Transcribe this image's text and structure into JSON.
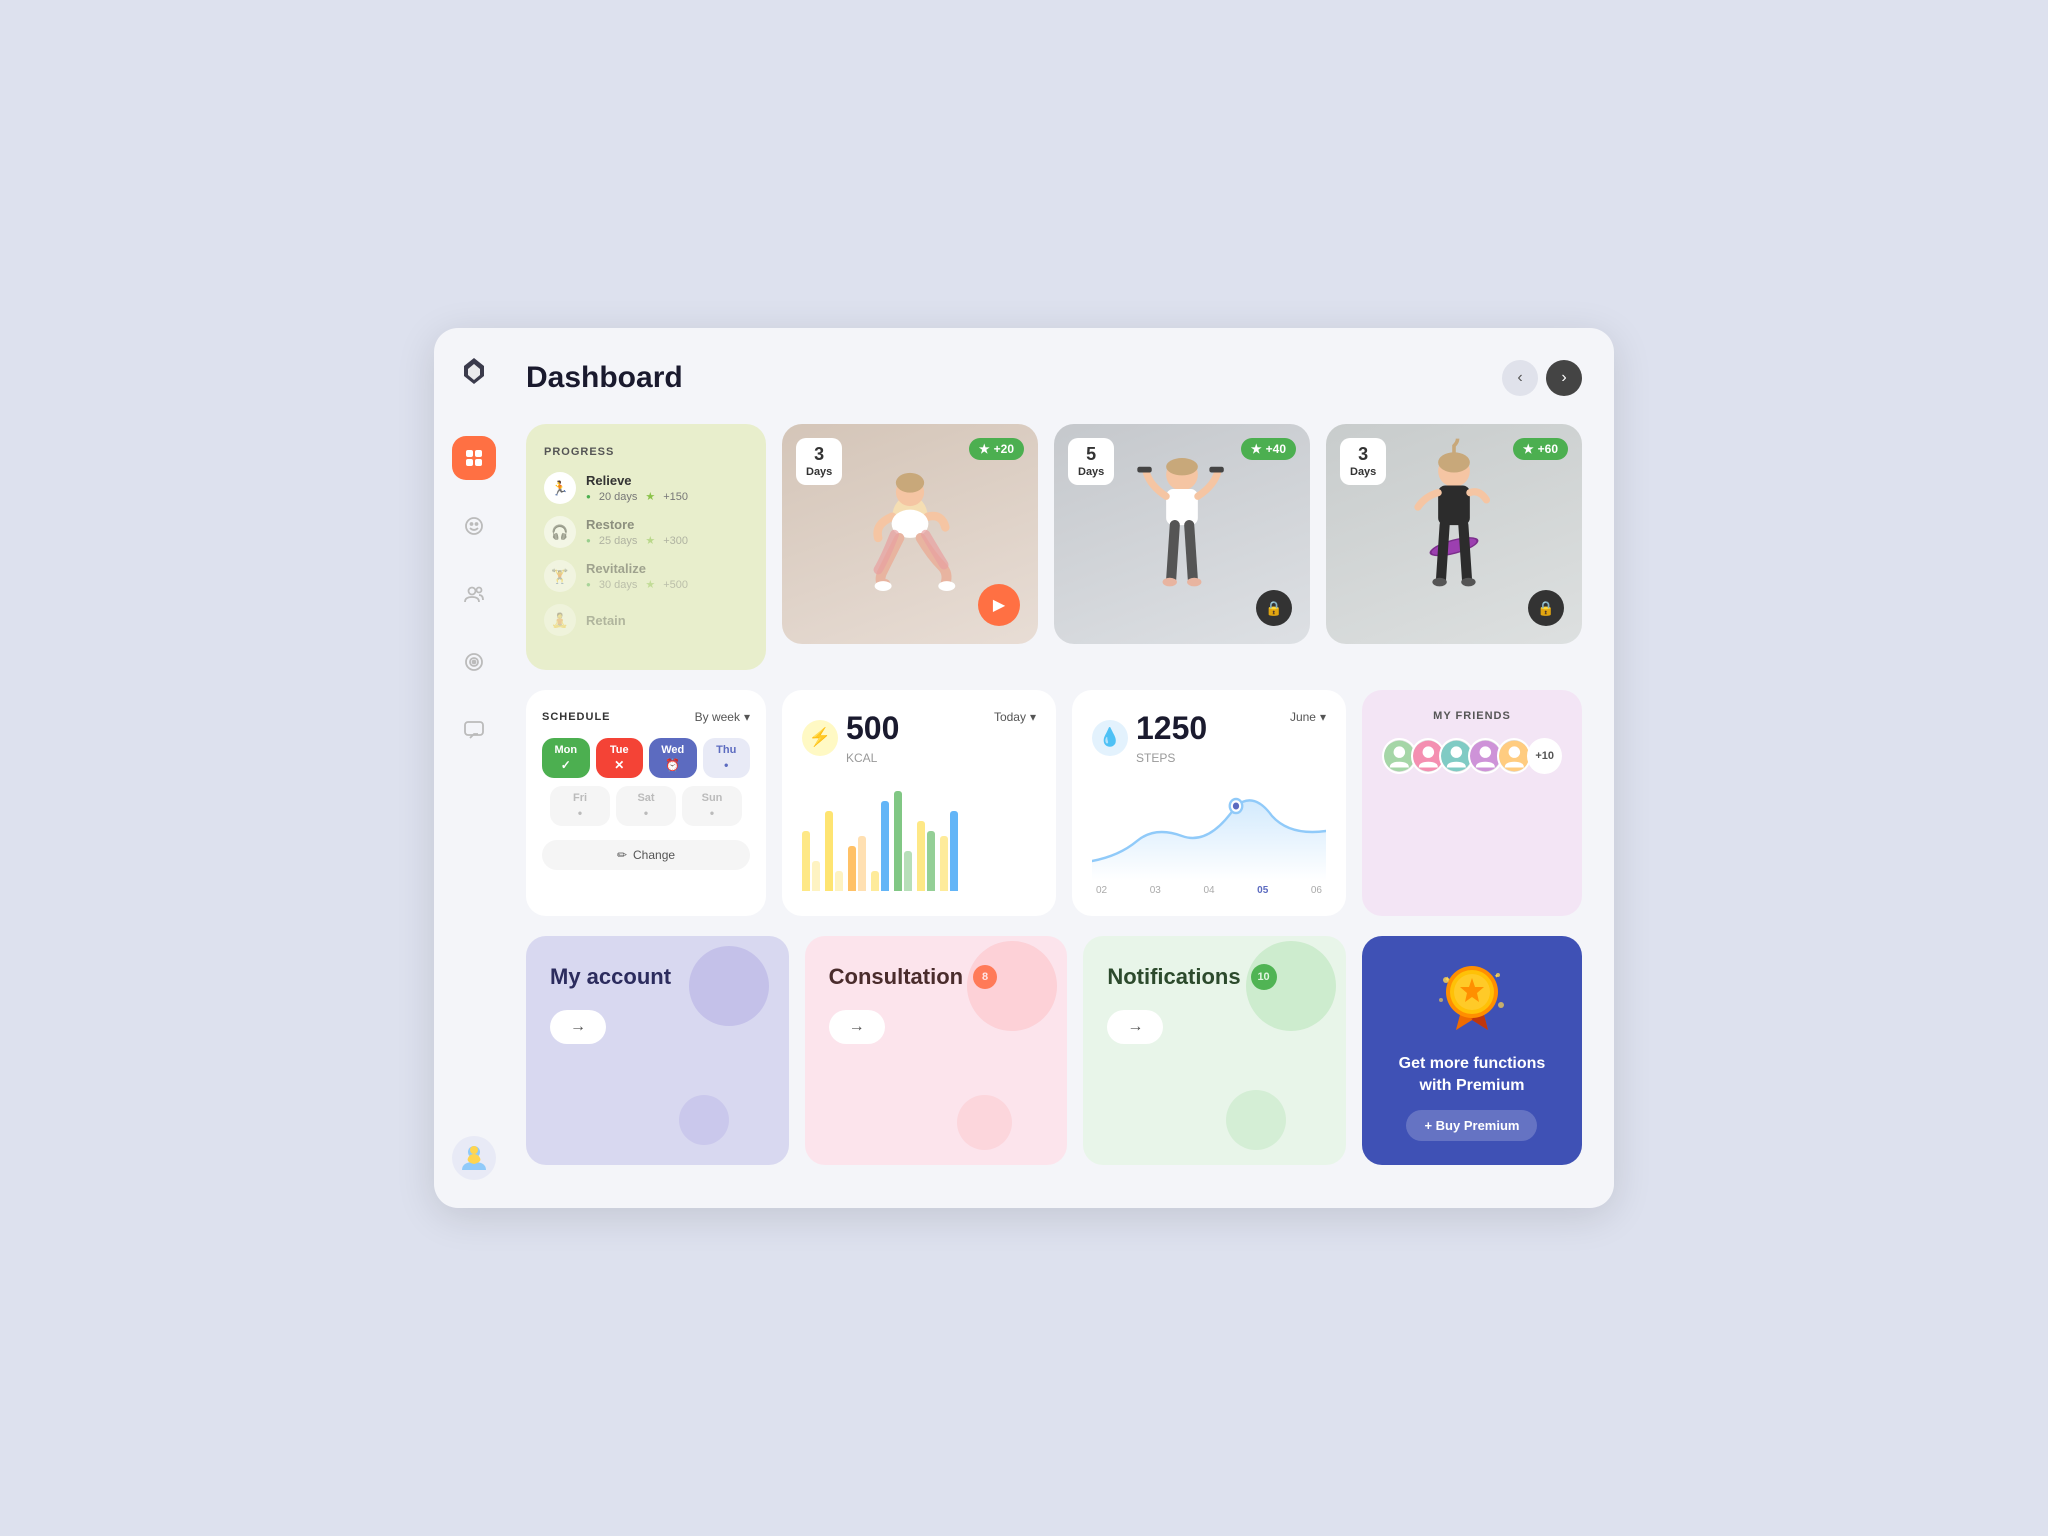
{
  "app": {
    "title": "Dashboard",
    "logo": "⚡"
  },
  "sidebar": {
    "items": [
      {
        "id": "dashboard",
        "icon": "▦",
        "active": true
      },
      {
        "id": "smiley",
        "icon": "☺"
      },
      {
        "id": "users",
        "icon": "👥"
      },
      {
        "id": "target",
        "icon": "◎"
      },
      {
        "id": "chat",
        "icon": "💬"
      }
    ],
    "avatar": "👤"
  },
  "header": {
    "title": "Dashboard",
    "nav_prev": "‹",
    "nav_next": "›"
  },
  "progress": {
    "title": "PROGRESS",
    "items": [
      {
        "name": "Relieve",
        "days": "20 days",
        "points": "+150",
        "active": true,
        "icon": "🏃"
      },
      {
        "name": "Restore",
        "days": "25 days",
        "points": "+300",
        "active": false,
        "icon": "🎧"
      },
      {
        "name": "Revitalize",
        "days": "30 days",
        "points": "+500",
        "active": false,
        "icon": "🏋"
      },
      {
        "name": "Retain",
        "days": "",
        "points": "",
        "active": false,
        "icon": "🧘"
      }
    ]
  },
  "workouts": [
    {
      "days": "3",
      "label": "Days",
      "points": "+20",
      "hasPlay": true
    },
    {
      "days": "5",
      "label": "Days",
      "points": "+40",
      "hasPlay": false
    },
    {
      "days": "3",
      "label": "Days",
      "points": "+60",
      "hasPlay": false
    }
  ],
  "schedule": {
    "title": "SCHEDULE",
    "view": "By week",
    "days": [
      {
        "label": "Mon",
        "style": "mon",
        "icon": "✓"
      },
      {
        "label": "Tue",
        "style": "tue",
        "icon": "✕"
      },
      {
        "label": "Wed",
        "style": "wed",
        "icon": "⏰"
      },
      {
        "label": "Thu",
        "style": "thu",
        "icon": "•"
      },
      {
        "label": "Fri",
        "style": "inactive",
        "icon": "•"
      },
      {
        "label": "Sat",
        "style": "inactive",
        "icon": "•"
      },
      {
        "label": "Sun",
        "style": "inactive",
        "icon": "•"
      }
    ],
    "change_btn": "Change"
  },
  "calories": {
    "value": "500",
    "unit": "KCAL",
    "period": "Today",
    "icon": "⚡",
    "bars": [
      {
        "h1": 60,
        "h2": 30,
        "c1": "#fdd835",
        "c2": "#fdd835"
      },
      {
        "h1": 80,
        "h2": 20,
        "c1": "#fdd835",
        "c2": "#fdd835"
      },
      {
        "h1": 40,
        "h2": 50,
        "c1": "#ff9800",
        "c2": "#ff9800"
      },
      {
        "h1": 20,
        "h2": 90,
        "c1": "#fdd835",
        "c2": "#2196f3"
      },
      {
        "h1": 100,
        "h2": 40,
        "c1": "#4caf50",
        "c2": "#4caf50"
      },
      {
        "h1": 70,
        "h2": 60,
        "c1": "#fdd835",
        "c2": "#4caf50"
      },
      {
        "h1": 55,
        "h2": 80,
        "c1": "#fdd835",
        "c2": "#2196f3"
      }
    ]
  },
  "steps": {
    "value": "1250",
    "unit": "STEPS",
    "period": "June",
    "icon": "💧",
    "labels": [
      "02",
      "03",
      "04",
      "05",
      "06"
    ],
    "highlight_label": "05"
  },
  "friends": {
    "title": "MY FRIENDS",
    "avatars": [
      "🧑",
      "👩",
      "👦",
      "👧",
      "🧒"
    ],
    "extra": "+10"
  },
  "account": {
    "title": "My account",
    "arrow": "→"
  },
  "consultation": {
    "title": "Consultation",
    "badge": "8",
    "arrow": "→"
  },
  "notifications": {
    "title": "Notifications",
    "badge": "10",
    "arrow": "→"
  },
  "premium": {
    "title": "Get more functions with Premium",
    "button": "+ Buy Premium",
    "medal": "🏅"
  }
}
